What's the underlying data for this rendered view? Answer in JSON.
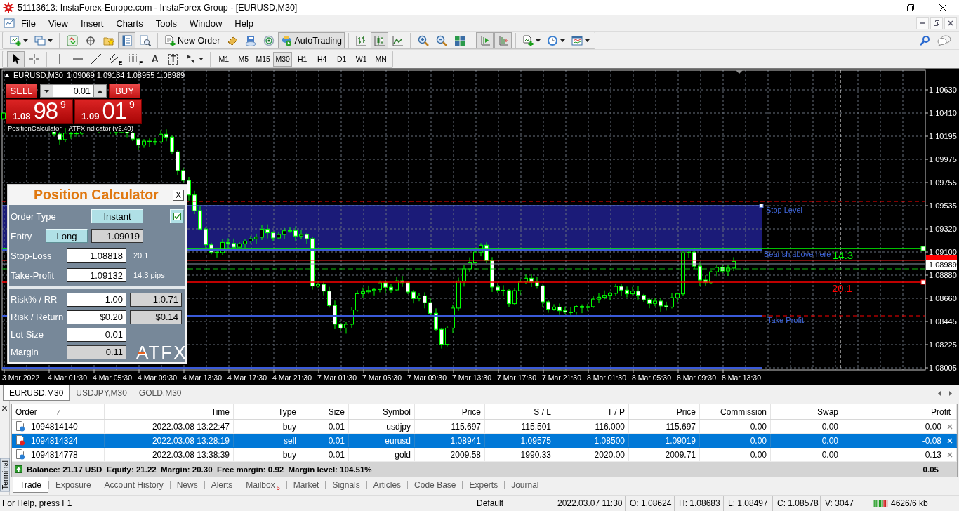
{
  "window": {
    "title": "51113613: InstaForex-Europe.com - InstaForex Group - [EURUSD,M30]"
  },
  "menu": [
    "File",
    "View",
    "Insert",
    "Charts",
    "Tools",
    "Window",
    "Help"
  ],
  "toolbar": {
    "groups": [
      [
        {
          "kind": "new_chart",
          "pressed": false
        },
        {
          "kind": "profiles",
          "pressed": false
        }
      ],
      [
        {
          "kind": "market_watch",
          "pressed": false
        },
        {
          "kind": "data_window",
          "pressed": false
        },
        {
          "kind": "navigator",
          "pressed": false
        },
        {
          "kind": "terminal",
          "pressed": true
        },
        {
          "kind": "tester",
          "pressed": false
        }
      ],
      [
        {
          "kind": "new_order",
          "label": "New Order",
          "pressed": false
        },
        {
          "kind": "editor",
          "pressed": false
        },
        {
          "kind": "cloud",
          "pressed": false
        },
        {
          "kind": "signals",
          "pressed": false
        },
        {
          "kind": "auto_trading",
          "label": "AutoTrading",
          "pressed": true
        }
      ],
      [
        {
          "kind": "bar_chart",
          "pressed": false
        },
        {
          "kind": "candles",
          "pressed": true
        },
        {
          "kind": "line_chart",
          "pressed": false
        }
      ],
      [
        {
          "kind": "zoom_in",
          "pressed": false
        },
        {
          "kind": "zoom_out",
          "pressed": false
        },
        {
          "kind": "tile",
          "pressed": false
        }
      ],
      [
        {
          "kind": "chart_shift",
          "pressed": true
        },
        {
          "kind": "auto_scroll",
          "pressed": true
        }
      ],
      [
        {
          "kind": "indicators",
          "pressed": false
        },
        {
          "kind": "periods",
          "pressed": false
        },
        {
          "kind": "templates",
          "pressed": false
        }
      ]
    ]
  },
  "drawing_tools": {
    "groups": [
      [
        {
          "kind": "cursor",
          "pressed": true
        },
        {
          "kind": "crosshair",
          "pressed": false
        }
      ],
      [
        {
          "kind": "vline",
          "pressed": false
        },
        {
          "kind": "hline",
          "pressed": false
        },
        {
          "kind": "trendline",
          "pressed": false
        },
        {
          "kind": "channel",
          "mark": "E",
          "pressed": false
        },
        {
          "kind": "fibo",
          "mark": "F",
          "pressed": false
        },
        {
          "kind": "text",
          "glyph": "A",
          "pressed": false
        },
        {
          "kind": "label",
          "glyph": "T",
          "pressed": false
        },
        {
          "kind": "arrows",
          "pressed": false
        }
      ]
    ]
  },
  "timeframes": [
    {
      "label": "M1",
      "selected": false
    },
    {
      "label": "M5",
      "selected": false
    },
    {
      "label": "M15",
      "selected": false
    },
    {
      "label": "M30",
      "selected": true
    },
    {
      "label": "H1",
      "selected": false
    },
    {
      "label": "H4",
      "selected": false
    },
    {
      "label": "D1",
      "selected": false
    },
    {
      "label": "W1",
      "selected": false
    },
    {
      "label": "MN",
      "selected": false
    }
  ],
  "chart": {
    "symbol": "EURUSD,M30",
    "quotes": "1.09069 1.09134 1.08955 1.08989",
    "one_click": {
      "sell": {
        "label": "SELL",
        "big": "1.08",
        "pips": "98",
        "point": "9"
      },
      "lot": "0.01",
      "buy": {
        "label": "BUY",
        "big": "1.09",
        "pips": "01",
        "point": "9"
      }
    },
    "indicators": [
      "PositionCalculator",
      "ATFXIndicator (v2.40)"
    ],
    "annotations": [
      {
        "kind": "label",
        "text": "Stop Level",
        "color": "#4169e1"
      },
      {
        "kind": "label",
        "text": "Bearish above here",
        "color": "#4169e1"
      },
      {
        "kind": "pips",
        "text": "14.3",
        "color": "#00ff00"
      },
      {
        "kind": "pips",
        "text": "20.1",
        "color": "#ff0000"
      },
      {
        "kind": "label",
        "text": "Take Profit",
        "color": "#4169e1"
      }
    ],
    "price_axis": [
      "1.10630",
      "1.10410",
      "1.10195",
      "1.09975",
      "1.09755",
      "1.09535",
      "1.09320",
      "1.09100",
      "1.08880",
      "1.08660",
      "1.08445",
      "1.08225",
      "1.08005"
    ],
    "bid": "1.08989",
    "time_axis": [
      "3 Mar 2022",
      "4 Mar 01:30",
      "4 Mar 05:30",
      "4 Mar 09:30",
      "4 Mar 13:30",
      "4 Mar 17:30",
      "4 Mar 21:30",
      "7 Mar 01:30",
      "7 Mar 05:30",
      "7 Mar 09:30",
      "7 Mar 13:30",
      "7 Mar 17:30",
      "7 Mar 21:30",
      "8 Mar 01:30",
      "8 Mar 05:30",
      "8 Mar 09:30",
      "8 Mar 13:30"
    ]
  },
  "position_calculator": {
    "title": "Position Calculator",
    "close": "X",
    "sections": [
      {
        "rows": [
          {
            "kind": "choice",
            "label": "Order Type",
            "cells": [
              {
                "kind": "button",
                "text": "Instant"
              },
              {
                "kind": "checkbox",
                "checked": true
              }
            ]
          },
          {
            "kind": "entry",
            "label": "Entry",
            "cells": [
              {
                "kind": "button",
                "text": "Long"
              },
              {
                "kind": "readonly",
                "text": "1.09019"
              }
            ]
          },
          {
            "kind": "input_note",
            "label": "Stop-Loss",
            "cells": [
              {
                "kind": "input",
                "text": "1.08818"
              },
              {
                "kind": "note",
                "text": "20.1"
              }
            ]
          },
          {
            "kind": "input_note",
            "label": "Take-Profit",
            "cells": [
              {
                "kind": "input",
                "text": "1.09132"
              },
              {
                "kind": "note",
                "text": "14.3 pips"
              }
            ]
          }
        ]
      },
      {
        "rows": [
          {
            "kind": "input_pair",
            "label": "Risk% / RR",
            "cells": [
              {
                "kind": "input",
                "text": "1.00"
              },
              {
                "kind": "readonly",
                "text": "1:0.71"
              }
            ]
          },
          {
            "kind": "input_pair",
            "label": "Risk / Return",
            "cells": [
              {
                "kind": "input",
                "text": "$0.20"
              },
              {
                "kind": "readonly",
                "text": "$0.14"
              }
            ]
          },
          {
            "kind": "input",
            "label": "Lot Size",
            "cells": [
              {
                "kind": "input",
                "text": "0.01"
              }
            ]
          },
          {
            "kind": "readonly_logo",
            "label": "Margin",
            "cells": [
              {
                "kind": "readonly",
                "text": "0.11"
              },
              {
                "kind": "logo",
                "text": "ATFX"
              }
            ]
          }
        ]
      }
    ]
  },
  "chart_tabs": [
    {
      "label": "EURUSD,M30",
      "selected": true
    },
    {
      "label": "USDJPY,M30",
      "selected": false
    },
    {
      "label": "GOLD,M30",
      "selected": false
    }
  ],
  "terminal": {
    "label": "Terminal",
    "columns": [
      "Order",
      "Time",
      "Type",
      "Size",
      "Symbol",
      "Price",
      "S / L",
      "T / P",
      "Price",
      "Commission",
      "Swap",
      "Profit"
    ],
    "rows": [
      {
        "selected": false,
        "color": "#2a7fd4",
        "cells": [
          "1094814140",
          "2022.03.08 13:22:47",
          "buy",
          "0.01",
          "usdjpy",
          "115.697",
          "115.501",
          "116.000",
          "115.697",
          "0.00",
          "0.00",
          "0.00"
        ]
      },
      {
        "selected": true,
        "color": "#e02020",
        "cells": [
          "1094814324",
          "2022.03.08 13:28:19",
          "sell",
          "0.01",
          "eurusd",
          "1.08941",
          "1.09575",
          "1.08500",
          "1.09019",
          "0.00",
          "0.00",
          "-0.08"
        ]
      },
      {
        "selected": false,
        "color": "#2a7fd4",
        "cells": [
          "1094814778",
          "2022.03.08 13:38:39",
          "buy",
          "0.01",
          "gold",
          "2009.58",
          "1990.33",
          "2020.00",
          "2009.71",
          "0.00",
          "0.00",
          "0.13"
        ]
      }
    ],
    "summary": "Balance: 21.17 USD  Equity: 21.22  Margin: 20.30  Free margin: 0.92  Margin level: 104.51%",
    "total": "0.05",
    "tabs": [
      {
        "label": "Trade",
        "selected": true
      },
      {
        "label": "Exposure",
        "selected": false
      },
      {
        "label": "Account History",
        "selected": false
      },
      {
        "label": "News",
        "selected": false
      },
      {
        "label": "Alerts",
        "selected": false
      },
      {
        "label": "Mailbox",
        "badge": "6",
        "selected": false
      },
      {
        "label": "Market",
        "selected": false
      },
      {
        "label": "Signals",
        "selected": false
      },
      {
        "label": "Articles",
        "selected": false
      },
      {
        "label": "Code Base",
        "selected": false
      },
      {
        "label": "Experts",
        "selected": false
      },
      {
        "label": "Journal",
        "selected": false
      }
    ]
  },
  "status_bar": {
    "help": "For Help, press F1",
    "profile": "Default",
    "time": "2022.03.07 11:30",
    "open": "O: 1.08624",
    "high": "H: 1.08683",
    "low": "L: 1.08497",
    "close": "C: 1.08578",
    "volume": "V: 3047",
    "traffic": "4626/6 kb"
  }
}
